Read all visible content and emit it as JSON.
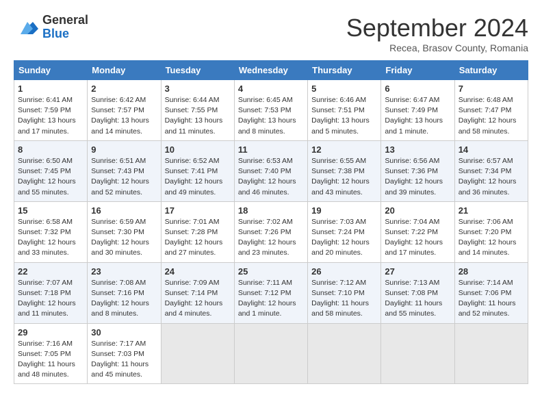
{
  "header": {
    "logo_general": "General",
    "logo_blue": "Blue",
    "month_title": "September 2024",
    "subtitle": "Recea, Brasov County, Romania"
  },
  "columns": [
    "Sunday",
    "Monday",
    "Tuesday",
    "Wednesday",
    "Thursday",
    "Friday",
    "Saturday"
  ],
  "weeks": [
    [
      {
        "day": "1",
        "lines": [
          "Sunrise: 6:41 AM",
          "Sunset: 7:59 PM",
          "Daylight: 13 hours",
          "and 17 minutes."
        ]
      },
      {
        "day": "2",
        "lines": [
          "Sunrise: 6:42 AM",
          "Sunset: 7:57 PM",
          "Daylight: 13 hours",
          "and 14 minutes."
        ]
      },
      {
        "day": "3",
        "lines": [
          "Sunrise: 6:44 AM",
          "Sunset: 7:55 PM",
          "Daylight: 13 hours",
          "and 11 minutes."
        ]
      },
      {
        "day": "4",
        "lines": [
          "Sunrise: 6:45 AM",
          "Sunset: 7:53 PM",
          "Daylight: 13 hours",
          "and 8 minutes."
        ]
      },
      {
        "day": "5",
        "lines": [
          "Sunrise: 6:46 AM",
          "Sunset: 7:51 PM",
          "Daylight: 13 hours",
          "and 5 minutes."
        ]
      },
      {
        "day": "6",
        "lines": [
          "Sunrise: 6:47 AM",
          "Sunset: 7:49 PM",
          "Daylight: 13 hours",
          "and 1 minute."
        ]
      },
      {
        "day": "7",
        "lines": [
          "Sunrise: 6:48 AM",
          "Sunset: 7:47 PM",
          "Daylight: 12 hours",
          "and 58 minutes."
        ]
      }
    ],
    [
      {
        "day": "8",
        "lines": [
          "Sunrise: 6:50 AM",
          "Sunset: 7:45 PM",
          "Daylight: 12 hours",
          "and 55 minutes."
        ]
      },
      {
        "day": "9",
        "lines": [
          "Sunrise: 6:51 AM",
          "Sunset: 7:43 PM",
          "Daylight: 12 hours",
          "and 52 minutes."
        ]
      },
      {
        "day": "10",
        "lines": [
          "Sunrise: 6:52 AM",
          "Sunset: 7:41 PM",
          "Daylight: 12 hours",
          "and 49 minutes."
        ]
      },
      {
        "day": "11",
        "lines": [
          "Sunrise: 6:53 AM",
          "Sunset: 7:40 PM",
          "Daylight: 12 hours",
          "and 46 minutes."
        ]
      },
      {
        "day": "12",
        "lines": [
          "Sunrise: 6:55 AM",
          "Sunset: 7:38 PM",
          "Daylight: 12 hours",
          "and 43 minutes."
        ]
      },
      {
        "day": "13",
        "lines": [
          "Sunrise: 6:56 AM",
          "Sunset: 7:36 PM",
          "Daylight: 12 hours",
          "and 39 minutes."
        ]
      },
      {
        "day": "14",
        "lines": [
          "Sunrise: 6:57 AM",
          "Sunset: 7:34 PM",
          "Daylight: 12 hours",
          "and 36 minutes."
        ]
      }
    ],
    [
      {
        "day": "15",
        "lines": [
          "Sunrise: 6:58 AM",
          "Sunset: 7:32 PM",
          "Daylight: 12 hours",
          "and 33 minutes."
        ]
      },
      {
        "day": "16",
        "lines": [
          "Sunrise: 6:59 AM",
          "Sunset: 7:30 PM",
          "Daylight: 12 hours",
          "and 30 minutes."
        ]
      },
      {
        "day": "17",
        "lines": [
          "Sunrise: 7:01 AM",
          "Sunset: 7:28 PM",
          "Daylight: 12 hours",
          "and 27 minutes."
        ]
      },
      {
        "day": "18",
        "lines": [
          "Sunrise: 7:02 AM",
          "Sunset: 7:26 PM",
          "Daylight: 12 hours",
          "and 23 minutes."
        ]
      },
      {
        "day": "19",
        "lines": [
          "Sunrise: 7:03 AM",
          "Sunset: 7:24 PM",
          "Daylight: 12 hours",
          "and 20 minutes."
        ]
      },
      {
        "day": "20",
        "lines": [
          "Sunrise: 7:04 AM",
          "Sunset: 7:22 PM",
          "Daylight: 12 hours",
          "and 17 minutes."
        ]
      },
      {
        "day": "21",
        "lines": [
          "Sunrise: 7:06 AM",
          "Sunset: 7:20 PM",
          "Daylight: 12 hours",
          "and 14 minutes."
        ]
      }
    ],
    [
      {
        "day": "22",
        "lines": [
          "Sunrise: 7:07 AM",
          "Sunset: 7:18 PM",
          "Daylight: 12 hours",
          "and 11 minutes."
        ]
      },
      {
        "day": "23",
        "lines": [
          "Sunrise: 7:08 AM",
          "Sunset: 7:16 PM",
          "Daylight: 12 hours",
          "and 8 minutes."
        ]
      },
      {
        "day": "24",
        "lines": [
          "Sunrise: 7:09 AM",
          "Sunset: 7:14 PM",
          "Daylight: 12 hours",
          "and 4 minutes."
        ]
      },
      {
        "day": "25",
        "lines": [
          "Sunrise: 7:11 AM",
          "Sunset: 7:12 PM",
          "Daylight: 12 hours",
          "and 1 minute."
        ]
      },
      {
        "day": "26",
        "lines": [
          "Sunrise: 7:12 AM",
          "Sunset: 7:10 PM",
          "Daylight: 11 hours",
          "and 58 minutes."
        ]
      },
      {
        "day": "27",
        "lines": [
          "Sunrise: 7:13 AM",
          "Sunset: 7:08 PM",
          "Daylight: 11 hours",
          "and 55 minutes."
        ]
      },
      {
        "day": "28",
        "lines": [
          "Sunrise: 7:14 AM",
          "Sunset: 7:06 PM",
          "Daylight: 11 hours",
          "and 52 minutes."
        ]
      }
    ],
    [
      {
        "day": "29",
        "lines": [
          "Sunrise: 7:16 AM",
          "Sunset: 7:05 PM",
          "Daylight: 11 hours",
          "and 48 minutes."
        ]
      },
      {
        "day": "30",
        "lines": [
          "Sunrise: 7:17 AM",
          "Sunset: 7:03 PM",
          "Daylight: 11 hours",
          "and 45 minutes."
        ]
      },
      null,
      null,
      null,
      null,
      null
    ]
  ]
}
